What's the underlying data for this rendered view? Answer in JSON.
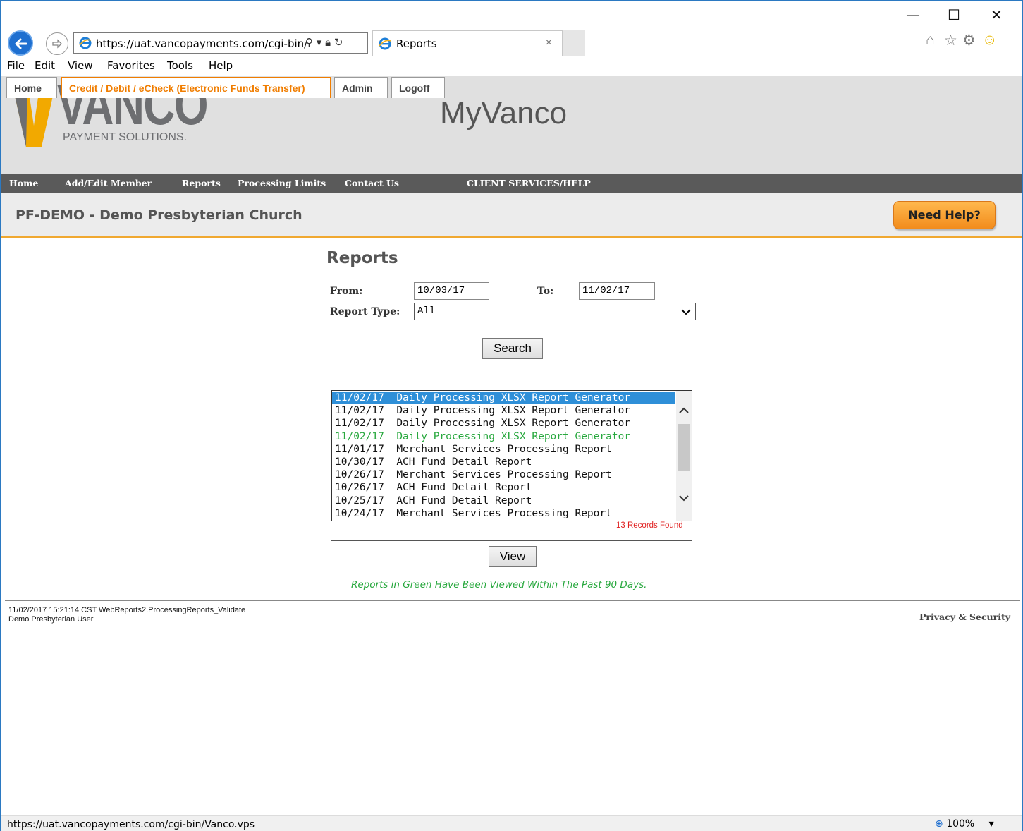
{
  "browser": {
    "url": "https://uat.vancopayments.com/cgi-bin/",
    "tab_title": "Reports",
    "tab_close": "×",
    "window_controls": {
      "minimize": "—",
      "maximize": "☐",
      "close": "✕"
    },
    "menu": [
      "File",
      "Edit",
      "View",
      "Favorites",
      "Tools",
      "Help"
    ],
    "status_url": "https://uat.vancopayments.com/cgi-bin/Vanco.vps",
    "zoom": "100%"
  },
  "site": {
    "logo_word": "VANCO",
    "logo_sub": "PAYMENT SOLUTIONS.",
    "title": "MyVanco",
    "tabs": [
      {
        "label": "Home",
        "active": false
      },
      {
        "label": "Credit / Debit / eCheck (Electronic Funds Transfer)",
        "active": true
      },
      {
        "label": "Admin",
        "active": false
      },
      {
        "label": "Logoff",
        "active": false
      }
    ],
    "nav": [
      "Home",
      "Add/Edit Member",
      "Reports",
      "Processing Limits",
      "Contact Us",
      "CLIENT SERVICES/HELP"
    ],
    "org_name": "PF-DEMO - Demo Presbyterian Church",
    "help_button": "Need Help?"
  },
  "reports": {
    "heading": "Reports",
    "from_label": "From:",
    "from_value": "10/03/17",
    "to_label": "To:",
    "to_value": "11/02/17",
    "type_label": "Report Type:",
    "type_value": "All",
    "search_button": "Search",
    "view_button": "View",
    "records_found": "13 Records Found",
    "viewed_note": "Reports in Green Have Been Viewed Within The Past 90 Days.",
    "items": [
      {
        "date": "11/02/17",
        "name": "Daily Processing XLSX Report Generator",
        "state": "selected"
      },
      {
        "date": "11/02/17",
        "name": "Daily Processing XLSX Report Generator",
        "state": "normal"
      },
      {
        "date": "11/02/17",
        "name": "Daily Processing XLSX Report Generator",
        "state": "normal"
      },
      {
        "date": "11/02/17",
        "name": "Daily Processing XLSX Report Generator",
        "state": "viewed"
      },
      {
        "date": "11/01/17",
        "name": "Merchant Services Processing Report",
        "state": "normal"
      },
      {
        "date": "10/30/17",
        "name": "ACH Fund Detail Report",
        "state": "normal"
      },
      {
        "date": "10/26/17",
        "name": "Merchant Services Processing Report",
        "state": "normal"
      },
      {
        "date": "10/26/17",
        "name": "ACH Fund Detail Report",
        "state": "normal"
      },
      {
        "date": "10/25/17",
        "name": "ACH Fund Detail Report",
        "state": "normal"
      },
      {
        "date": "10/24/17",
        "name": "Merchant Services Processing Report",
        "state": "normal"
      }
    ]
  },
  "footer": {
    "line1": "11/02/2017 15:21:14 CST WebReports2.ProcessingReports_Validate",
    "line2": "Demo Presbyterian User",
    "privacy": "Privacy & Security"
  },
  "colors": {
    "accent_orange": "#f07d00",
    "nav_gray": "#5a5a5a",
    "selected_blue": "#2e8fd8",
    "viewed_green": "#28a83e",
    "records_red": "#e02020"
  }
}
